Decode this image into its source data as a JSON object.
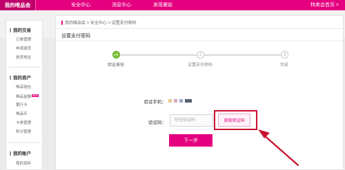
{
  "header": {
    "brand": "我的唯品会",
    "nav": [
      "安全中心",
      "消息中心",
      "发现邂逅"
    ],
    "right_text": "特卖会首页 >",
    "brand_color": "#e4007f"
  },
  "sidebar": {
    "sections": [
      {
        "title": "我的交易",
        "items": [
          "订单管理",
          "申请退货",
          "收货地址"
        ]
      },
      {
        "title": "我的资产",
        "items": [
          "唯品钱包",
          "唯品金融",
          "银行卡",
          "唯品币",
          "卡券管理",
          "积分管理"
        ],
        "badge": "NEW"
      },
      {
        "title": "我的账户",
        "items": [
          "我的资料"
        ]
      }
    ]
  },
  "main": {
    "breadcrumb": "我的唯品会 > 安全中心 > 设置支付密码",
    "panel_title": "设置支付密码",
    "steps": [
      {
        "label": "验证身份",
        "number": "",
        "state": "active"
      },
      {
        "label": "设置支付密码",
        "number": "2",
        "state": "pending"
      },
      {
        "label": "完成",
        "number": "3",
        "state": "pending"
      }
    ],
    "phone_label": "验证手机：",
    "code_label": "验证码：",
    "code_placeholder": "短信验证码",
    "get_code_button": "获取验证码",
    "next_button": "下一步",
    "annotation_color": "#c8102e"
  }
}
